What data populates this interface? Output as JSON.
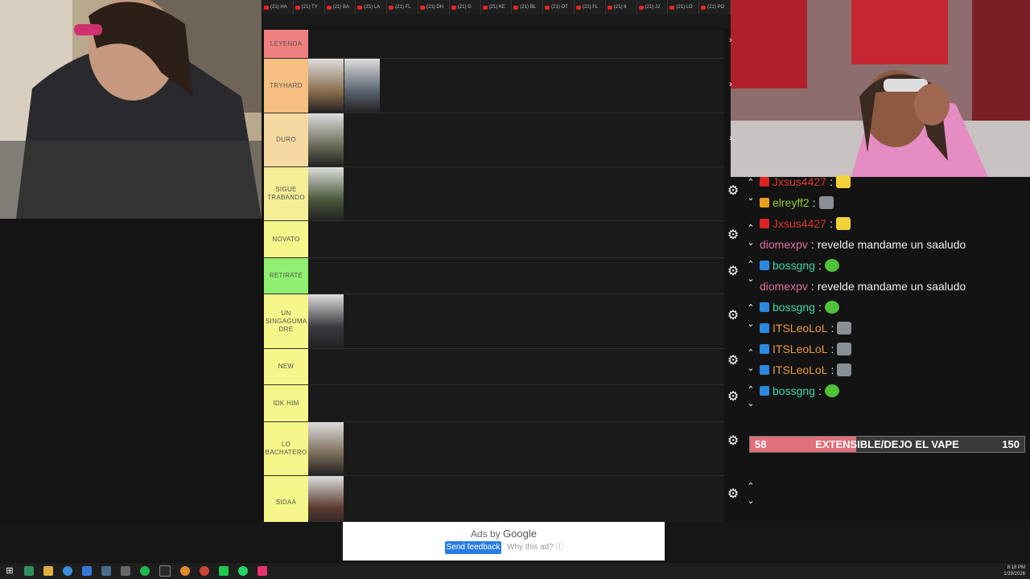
{
  "browser_tabs": [
    "(21) HA",
    "(21) TY",
    "(21) BA",
    "(21) LA",
    "(21) FL",
    "(21) DH",
    "(21) G",
    "(21) KE",
    "(21) BL",
    "(21) OT",
    "(21) FL",
    "(21) 6",
    "(21) JJ",
    "(21) LO",
    "(21) PO"
  ],
  "tiers": [
    {
      "label": "LEYENDA",
      "color": "#f08080",
      "thumbs": 0
    },
    {
      "label": "TRYHARD",
      "color": "#f5bf82",
      "thumbs": 2
    },
    {
      "label": "DURO",
      "color": "#f6d9a0",
      "thumbs": 1
    },
    {
      "label": "SIGUE TRABANDO",
      "color": "#f6ee96",
      "thumbs": 1
    },
    {
      "label": "NOVATO",
      "color": "#f6f68a",
      "thumbs": 0
    },
    {
      "label": "RETIRATE",
      "color": "#90ee70",
      "thumbs": 0
    },
    {
      "label": "UN SINGAGUMA DRE",
      "color": "#f6f68a",
      "thumbs": 1
    },
    {
      "label": "NEW",
      "color": "#f6f68a",
      "thumbs": 0
    },
    {
      "label": "IDK HIM",
      "color": "#f6f68a",
      "thumbs": 0
    },
    {
      "label": "LO BACHATERO",
      "color": "#f6f68a",
      "thumbs": 1
    },
    {
      "label": "SIDAA",
      "color": "#f6f68a",
      "thumbs": 1
    }
  ],
  "chat": [
    {
      "user": "Jxsus4427",
      "color": "#e0352c",
      "message": "",
      "emote": "yellow"
    },
    {
      "user": "elreyff2",
      "color": "#9acd32",
      "message": "",
      "emote": "face"
    },
    {
      "user": "Jxsus4427",
      "color": "#e0352c",
      "message": "",
      "emote": "yellow"
    },
    {
      "user": "diomexpv",
      "color": "#e06f9d",
      "message": "revelde mandame un saaludo",
      "emote": ""
    },
    {
      "user": "bossgng",
      "color": "#3dd6a8",
      "message": "",
      "emote": "green"
    },
    {
      "user": "diomexpv",
      "color": "#e06f9d",
      "message": "revelde mandame un saaludo",
      "emote": ""
    },
    {
      "user": "bossgng",
      "color": "#3dd6a8",
      "message": "",
      "emote": "green"
    },
    {
      "user": "ITSLeoLoL",
      "color": "#e89a3c",
      "message": "",
      "emote": "face"
    },
    {
      "user": "ITSLeoLoL",
      "color": "#e89a3c",
      "message": "",
      "emote": "face"
    },
    {
      "user": "ITSLeoLoL",
      "color": "#e89a3c",
      "message": "",
      "emote": "face"
    },
    {
      "user": "bossgng",
      "color": "#3dd6a8",
      "message": "",
      "emote": "green"
    }
  ],
  "goal": {
    "current": "58",
    "label": "EXTENSIBLE/DEJO EL VAPE",
    "target": "150",
    "progress": 0.386
  },
  "ad": {
    "by": "Ads by",
    "brand": "Google",
    "feedback": "Send feedback",
    "why": "Why this ad?"
  },
  "clock": {
    "time": "8:18 PM",
    "date": "1/29/2026"
  }
}
